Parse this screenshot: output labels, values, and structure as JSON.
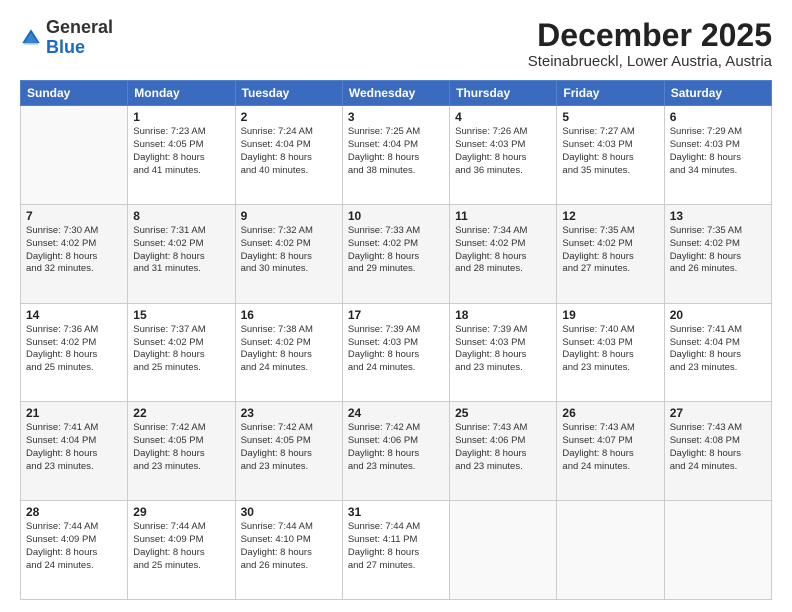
{
  "header": {
    "logo": {
      "general": "General",
      "blue": "Blue"
    },
    "title": "December 2025",
    "location": "Steinabrueckl, Lower Austria, Austria"
  },
  "days_of_week": [
    "Sunday",
    "Monday",
    "Tuesday",
    "Wednesday",
    "Thursday",
    "Friday",
    "Saturday"
  ],
  "weeks": [
    [
      {
        "day": "",
        "info": ""
      },
      {
        "day": "1",
        "info": "Sunrise: 7:23 AM\nSunset: 4:05 PM\nDaylight: 8 hours\nand 41 minutes."
      },
      {
        "day": "2",
        "info": "Sunrise: 7:24 AM\nSunset: 4:04 PM\nDaylight: 8 hours\nand 40 minutes."
      },
      {
        "day": "3",
        "info": "Sunrise: 7:25 AM\nSunset: 4:04 PM\nDaylight: 8 hours\nand 38 minutes."
      },
      {
        "day": "4",
        "info": "Sunrise: 7:26 AM\nSunset: 4:03 PM\nDaylight: 8 hours\nand 36 minutes."
      },
      {
        "day": "5",
        "info": "Sunrise: 7:27 AM\nSunset: 4:03 PM\nDaylight: 8 hours\nand 35 minutes."
      },
      {
        "day": "6",
        "info": "Sunrise: 7:29 AM\nSunset: 4:03 PM\nDaylight: 8 hours\nand 34 minutes."
      }
    ],
    [
      {
        "day": "7",
        "info": "Sunrise: 7:30 AM\nSunset: 4:02 PM\nDaylight: 8 hours\nand 32 minutes."
      },
      {
        "day": "8",
        "info": "Sunrise: 7:31 AM\nSunset: 4:02 PM\nDaylight: 8 hours\nand 31 minutes."
      },
      {
        "day": "9",
        "info": "Sunrise: 7:32 AM\nSunset: 4:02 PM\nDaylight: 8 hours\nand 30 minutes."
      },
      {
        "day": "10",
        "info": "Sunrise: 7:33 AM\nSunset: 4:02 PM\nDaylight: 8 hours\nand 29 minutes."
      },
      {
        "day": "11",
        "info": "Sunrise: 7:34 AM\nSunset: 4:02 PM\nDaylight: 8 hours\nand 28 minutes."
      },
      {
        "day": "12",
        "info": "Sunrise: 7:35 AM\nSunset: 4:02 PM\nDaylight: 8 hours\nand 27 minutes."
      },
      {
        "day": "13",
        "info": "Sunrise: 7:35 AM\nSunset: 4:02 PM\nDaylight: 8 hours\nand 26 minutes."
      }
    ],
    [
      {
        "day": "14",
        "info": "Sunrise: 7:36 AM\nSunset: 4:02 PM\nDaylight: 8 hours\nand 25 minutes."
      },
      {
        "day": "15",
        "info": "Sunrise: 7:37 AM\nSunset: 4:02 PM\nDaylight: 8 hours\nand 25 minutes."
      },
      {
        "day": "16",
        "info": "Sunrise: 7:38 AM\nSunset: 4:02 PM\nDaylight: 8 hours\nand 24 minutes."
      },
      {
        "day": "17",
        "info": "Sunrise: 7:39 AM\nSunset: 4:03 PM\nDaylight: 8 hours\nand 24 minutes."
      },
      {
        "day": "18",
        "info": "Sunrise: 7:39 AM\nSunset: 4:03 PM\nDaylight: 8 hours\nand 23 minutes."
      },
      {
        "day": "19",
        "info": "Sunrise: 7:40 AM\nSunset: 4:03 PM\nDaylight: 8 hours\nand 23 minutes."
      },
      {
        "day": "20",
        "info": "Sunrise: 7:41 AM\nSunset: 4:04 PM\nDaylight: 8 hours\nand 23 minutes."
      }
    ],
    [
      {
        "day": "21",
        "info": "Sunrise: 7:41 AM\nSunset: 4:04 PM\nDaylight: 8 hours\nand 23 minutes."
      },
      {
        "day": "22",
        "info": "Sunrise: 7:42 AM\nSunset: 4:05 PM\nDaylight: 8 hours\nand 23 minutes."
      },
      {
        "day": "23",
        "info": "Sunrise: 7:42 AM\nSunset: 4:05 PM\nDaylight: 8 hours\nand 23 minutes."
      },
      {
        "day": "24",
        "info": "Sunrise: 7:42 AM\nSunset: 4:06 PM\nDaylight: 8 hours\nand 23 minutes."
      },
      {
        "day": "25",
        "info": "Sunrise: 7:43 AM\nSunset: 4:06 PM\nDaylight: 8 hours\nand 23 minutes."
      },
      {
        "day": "26",
        "info": "Sunrise: 7:43 AM\nSunset: 4:07 PM\nDaylight: 8 hours\nand 24 minutes."
      },
      {
        "day": "27",
        "info": "Sunrise: 7:43 AM\nSunset: 4:08 PM\nDaylight: 8 hours\nand 24 minutes."
      }
    ],
    [
      {
        "day": "28",
        "info": "Sunrise: 7:44 AM\nSunset: 4:09 PM\nDaylight: 8 hours\nand 24 minutes."
      },
      {
        "day": "29",
        "info": "Sunrise: 7:44 AM\nSunset: 4:09 PM\nDaylight: 8 hours\nand 25 minutes."
      },
      {
        "day": "30",
        "info": "Sunrise: 7:44 AM\nSunset: 4:10 PM\nDaylight: 8 hours\nand 26 minutes."
      },
      {
        "day": "31",
        "info": "Sunrise: 7:44 AM\nSunset: 4:11 PM\nDaylight: 8 hours\nand 27 minutes."
      },
      {
        "day": "",
        "info": ""
      },
      {
        "day": "",
        "info": ""
      },
      {
        "day": "",
        "info": ""
      }
    ]
  ]
}
